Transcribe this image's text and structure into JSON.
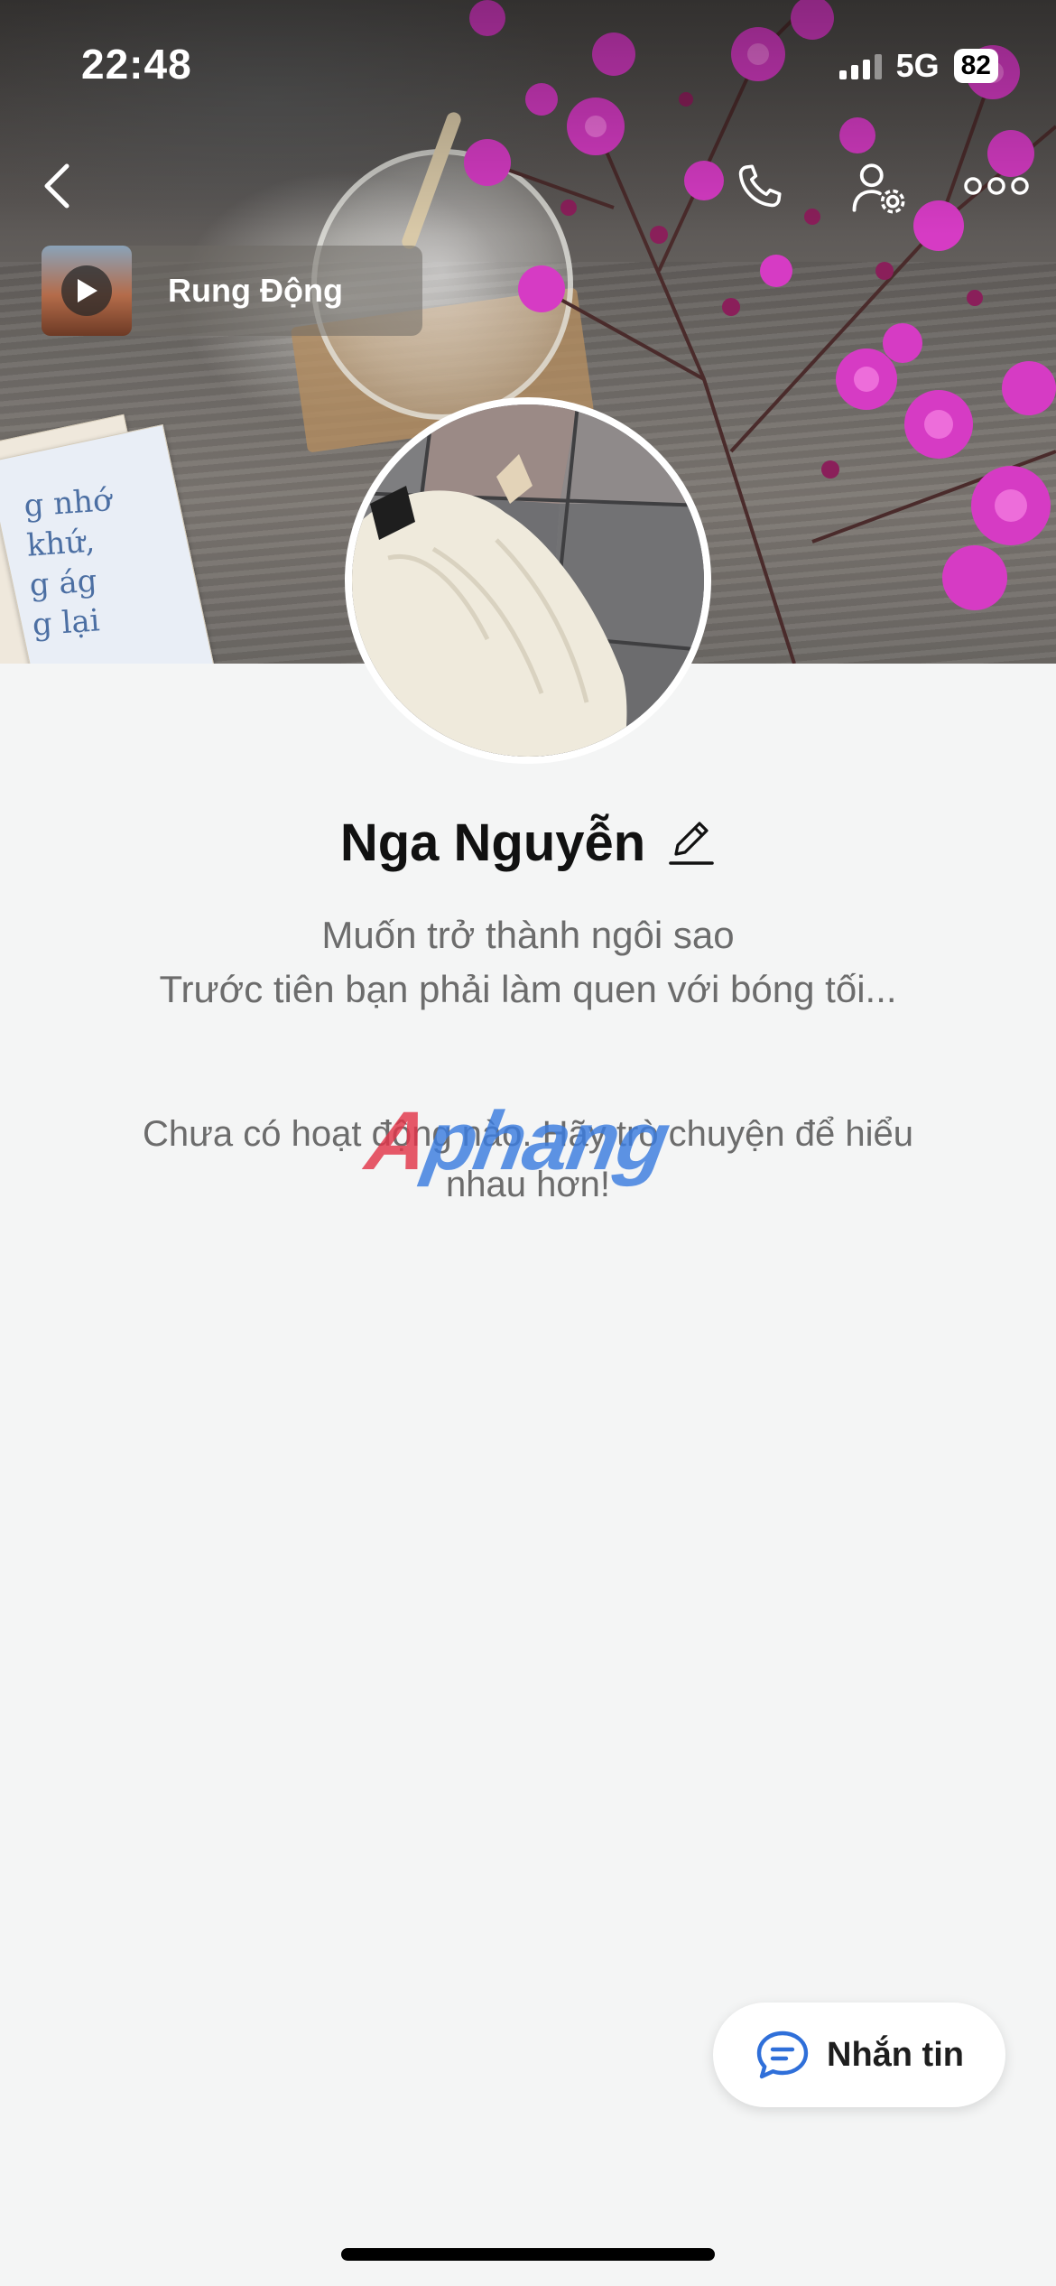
{
  "status_bar": {
    "time": "22:48",
    "network": "5G",
    "battery": "82"
  },
  "top_bar": {
    "back_icon": "chevron-left-icon",
    "call_icon": "phone-icon",
    "user_settings_icon": "user-settings-icon",
    "more_icon": "more-dots-icon"
  },
  "music": {
    "title": "Rung Động",
    "play_icon": "play-icon"
  },
  "cover": {
    "book_text": "g nhớ\nkhứ,\ng ág\ng lại"
  },
  "profile": {
    "name": "Nga Nguyễn",
    "bio_line1": "Muốn trở thành ngôi sao",
    "bio_line2": "Trước tiên bạn phải làm quen với bóng tối...",
    "empty_message": "Chưa có hoạt động nào. Hãy trò chuyện để hiểu nhau hơn!"
  },
  "watermark": {
    "part1": "A",
    "part2": "phang"
  },
  "actions": {
    "message_label": "Nhắn tin",
    "message_icon": "chat-bubble-icon"
  },
  "colors": {
    "accent_blue": "#3b7de0",
    "flower_pink": "#d63bc4",
    "background": "#f4f5f5"
  }
}
